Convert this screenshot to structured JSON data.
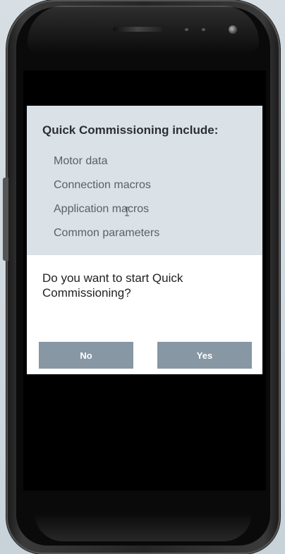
{
  "dialog": {
    "title": "Quick Commissioning include:",
    "items": [
      {
        "label": "Motor data"
      },
      {
        "label": "Connection macros"
      },
      {
        "label": "Application macros"
      },
      {
        "label": "Common parameters"
      }
    ],
    "question": "Do you want to start Quick Commissioning?",
    "buttons": {
      "no_label": "No",
      "yes_label": "Yes"
    }
  },
  "colors": {
    "info_background": "#dbe2e7",
    "button_background": "#8797a4",
    "button_text": "#ffffff",
    "dialog_background": "#ffffff"
  },
  "icons": [
    "text-cursor-icon",
    "camera-icon",
    "speaker-grille"
  ]
}
